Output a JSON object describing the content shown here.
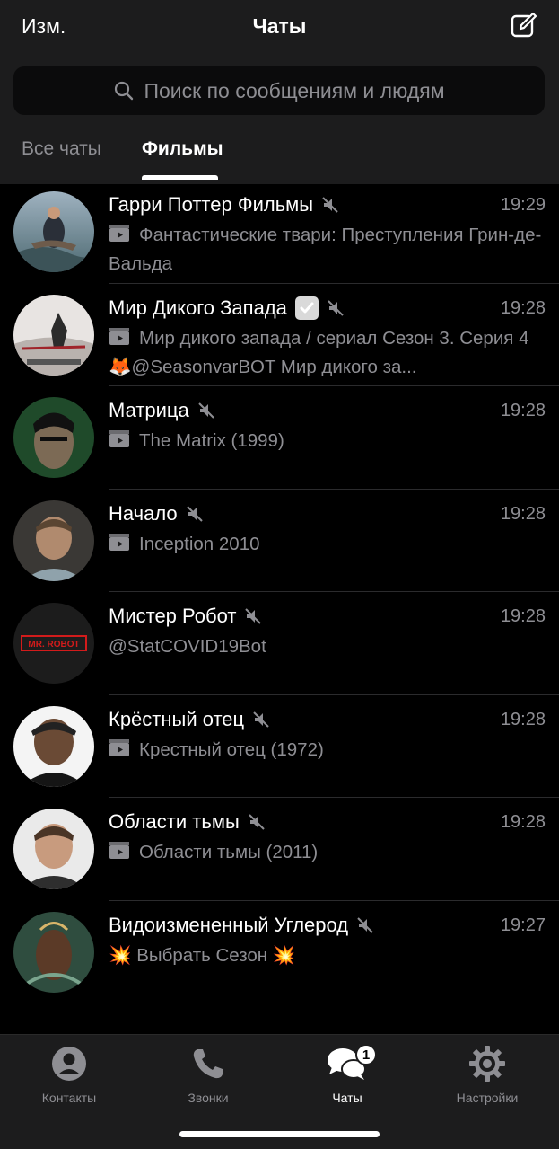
{
  "header": {
    "edit_label": "Изм.",
    "title": "Чаты",
    "search_placeholder": "Поиск по сообщениям и людям"
  },
  "folders": {
    "all": "Все чаты",
    "films": "Фильмы"
  },
  "chats": [
    {
      "name": "Гарри Поттер Фильмы",
      "time": "19:29",
      "preview_icon": "video-icon",
      "preview": "Фантастические твари: Преступления Грин-де-Вальда",
      "muted": true
    },
    {
      "name": "Мир Дикого Запада",
      "time": "19:28",
      "preview_icon": "video-icon",
      "preview": "Мир дикого запада  / сериал Сезон 3. Серия 4 🦊@SeasonvarBOT Мир дикого за...",
      "muted": true,
      "verified_check": true
    },
    {
      "name": "Матрица",
      "time": "19:28",
      "preview_icon": "video-icon",
      "preview": "The Matrix (1999)",
      "muted": true
    },
    {
      "name": "Начало",
      "time": "19:28",
      "preview_icon": "video-icon",
      "preview": "Inception 2010",
      "muted": true
    },
    {
      "name": "Мистер Робот",
      "time": "19:28",
      "preview": "@StatCOVID19Bot",
      "muted": true,
      "avatar_text": "MR. ROBOT"
    },
    {
      "name": "Крёстный отец",
      "time": "19:28",
      "preview_icon": "video-icon",
      "preview": "Крестный отец (1972)",
      "muted": true
    },
    {
      "name": "Области тьмы",
      "time": "19:28",
      "preview_icon": "video-icon",
      "preview": "Области тьмы (2011)",
      "muted": true
    },
    {
      "name": "Видоизмененный Углерод",
      "time": "19:27",
      "preview": "💥 Выбрать Сезон 💥",
      "muted": true
    }
  ],
  "tabbar": {
    "contacts": "Контакты",
    "calls": "Звонки",
    "chats": "Чаты",
    "chats_badge": "1",
    "settings": "Настройки"
  },
  "colors": {
    "background": "#000000",
    "bar": "#1c1c1d",
    "secondary_text": "#8e8e93"
  }
}
